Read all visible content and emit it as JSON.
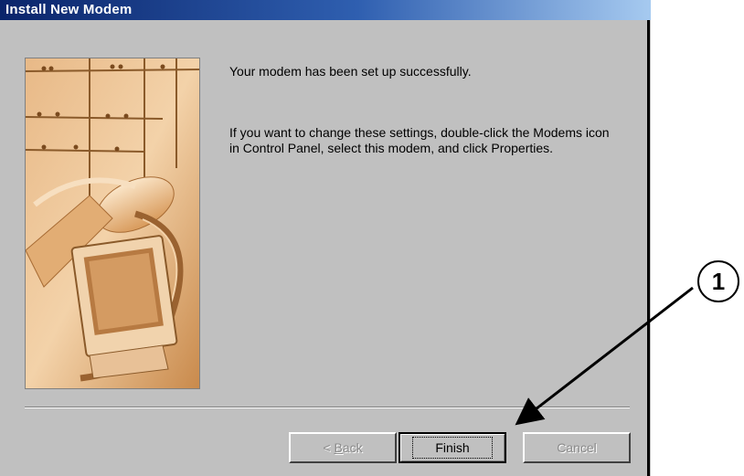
{
  "window": {
    "title": "Install New Modem"
  },
  "message": {
    "line1": "Your modem has been set up successfully.",
    "line2": "If you want to change these settings, double-click the Modems icon in Control Panel, select this modem, and click Properties."
  },
  "buttons": {
    "back_prefix": "< ",
    "back_access_key": "B",
    "back_rest": "ack",
    "finish": "Finish",
    "cancel": "Cancel"
  },
  "callout": {
    "number": "1"
  },
  "colors": {
    "titlebar_start": "#0a246a",
    "titlebar_end": "#a6caf0",
    "dialog_face": "#c0c0c0",
    "picture_tone": "#d9a066"
  },
  "icons": {
    "wizard_picture": "modem-wizard-illustration",
    "callout_arrow": "arrow-icon"
  }
}
